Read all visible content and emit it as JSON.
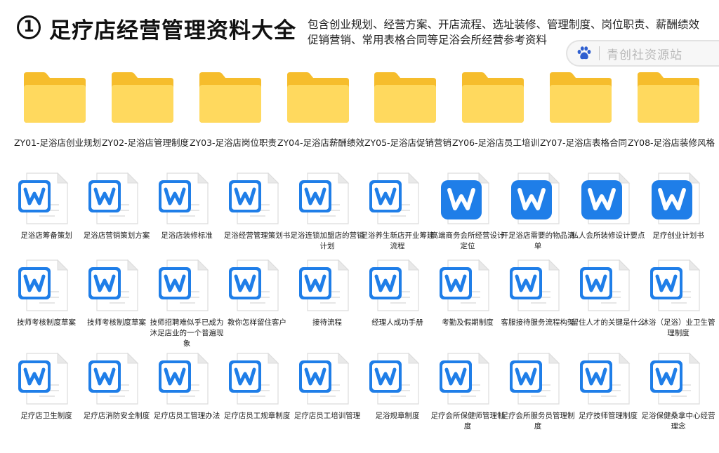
{
  "header": {
    "number": "1",
    "title": "足疗店经营管理资料大全",
    "subtitle": "包含创业规划、经营方案、开店流程、选址装修、管理制度、岗位职责、薪酬绩效促销营销、常用表格合同等足浴会所经营参考资料"
  },
  "watermark": {
    "icon": "paw-icon",
    "text": "青创社资源站"
  },
  "colors": {
    "folder_back": "#f6bd2c",
    "folder_front": "#ffd95e",
    "wps_blue": "#1f7ee8",
    "doc_paper": "#ffffff"
  },
  "folders": [
    {
      "label": "ZY01-足浴店创业规划"
    },
    {
      "label": "ZY02-足浴店管理制度"
    },
    {
      "label": "ZY03-足浴店岗位职责"
    },
    {
      "label": "ZY04-足浴店薪酬绩效"
    },
    {
      "label": "ZY05-足浴店促销营销"
    },
    {
      "label": "ZY06-足浴店员工培训"
    },
    {
      "label": "ZY07-足浴店表格合同"
    },
    {
      "label": "ZY08-足浴店装修风格"
    }
  ],
  "doc_rows": [
    [
      {
        "label": "足浴店筹备策划",
        "icon": "wps-doc-icon"
      },
      {
        "label": "足浴店营销策划方案",
        "icon": "wps-doc-icon"
      },
      {
        "label": "足浴店装修标准",
        "icon": "wps-doc-icon"
      },
      {
        "label": "足浴经营管理策划书",
        "icon": "wps-doc-icon"
      },
      {
        "label": "足浴连锁加盟店的营销计划",
        "icon": "wps-doc-icon"
      },
      {
        "label": "足浴养生新店开业筹建流程",
        "icon": "wps-doc-icon"
      },
      {
        "label": "高端商务会所经营设计定位",
        "icon": "wps-app-icon"
      },
      {
        "label": "开足浴店需要的物品清单",
        "icon": "wps-app-icon"
      },
      {
        "label": "私人会所装修设计要点",
        "icon": "wps-app-icon"
      },
      {
        "label": "足疗创业计划书",
        "icon": "wps-app-icon"
      }
    ],
    [
      {
        "label": "技师考核制度草案",
        "icon": "wps-doc-icon"
      },
      {
        "label": "技师考核制度草案",
        "icon": "wps-doc-icon"
      },
      {
        "label": "技师招聘难似乎已成为沐足店业的一个普遍现象",
        "icon": "wps-doc-icon"
      },
      {
        "label": "教你怎样留住客户",
        "icon": "wps-doc-icon"
      },
      {
        "label": "接待流程",
        "icon": "wps-doc-icon"
      },
      {
        "label": "经理人成功手册",
        "icon": "wps-doc-icon"
      },
      {
        "label": "考勤及假期制度",
        "icon": "wps-doc-icon"
      },
      {
        "label": "客服接待服务流程构架",
        "icon": "wps-doc-icon"
      },
      {
        "label": "留住人才的关键是什么",
        "icon": "wps-doc-icon"
      },
      {
        "label": "沐浴（足浴）业卫生管理制度",
        "icon": "wps-doc-icon"
      }
    ],
    [
      {
        "label": "足疗店卫生制度",
        "icon": "wps-doc-icon"
      },
      {
        "label": "足疗店消防安全制度",
        "icon": "wps-doc-icon"
      },
      {
        "label": "足疗店员工管理办法",
        "icon": "wps-doc-icon"
      },
      {
        "label": "足疗店员工规章制度",
        "icon": "wps-doc-icon"
      },
      {
        "label": "足疗店员工培训管理",
        "icon": "wps-doc-icon"
      },
      {
        "label": "足浴规章制度",
        "icon": "wps-doc-icon"
      },
      {
        "label": "足疗会所保健师管理制度",
        "icon": "wps-doc-icon"
      },
      {
        "label": "足疗会所服务员管理制度",
        "icon": "wps-doc-icon"
      },
      {
        "label": "足疗技师管理制度",
        "icon": "wps-doc-icon"
      },
      {
        "label": "足浴保健桑拿中心经营理念",
        "icon": "wps-doc-icon"
      }
    ]
  ]
}
